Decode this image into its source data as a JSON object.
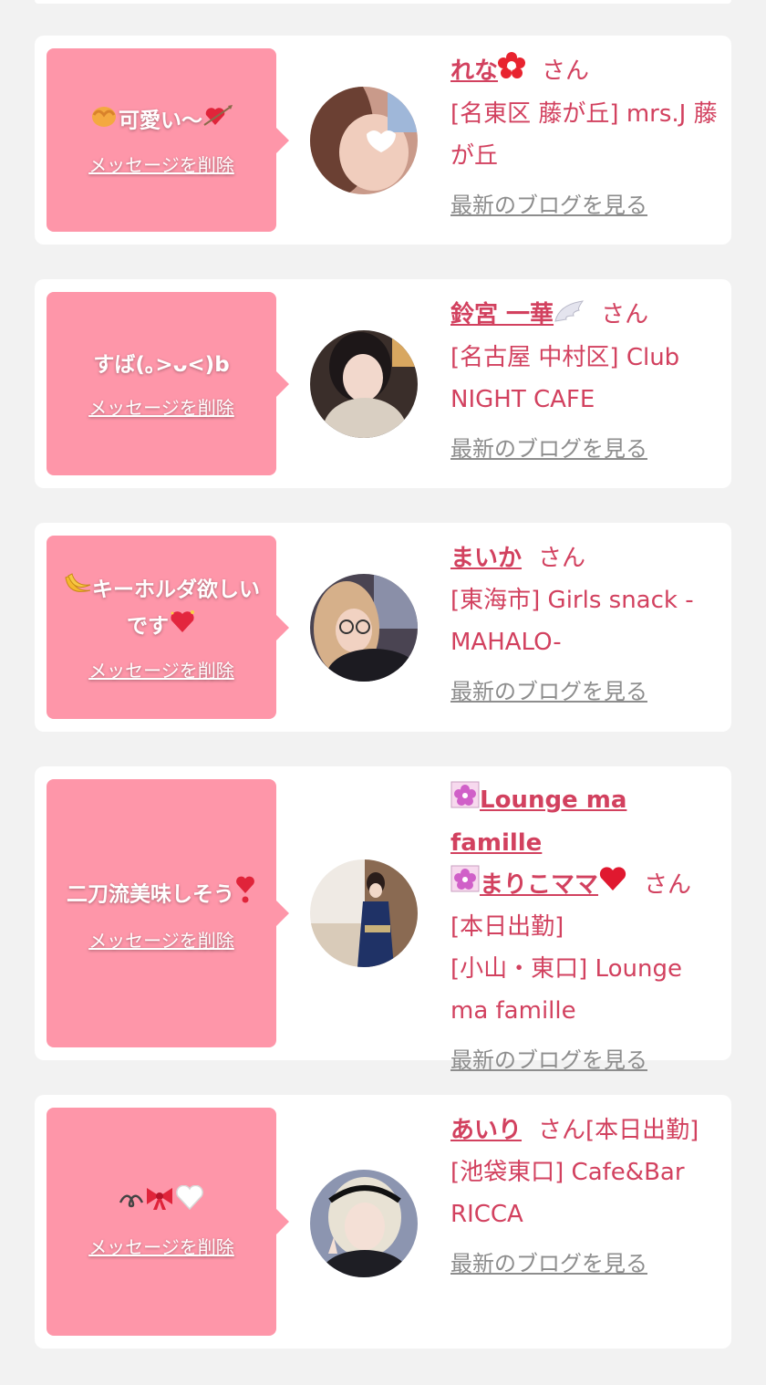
{
  "delete_label": "メッセージを削除",
  "blog_label": "最新のブログを見る",
  "san_label": "さん",
  "colors": {
    "background": "#f2f2f2",
    "bubble": "#fe96a9",
    "accent": "#d2415f",
    "link_gray": "#8d8d8d"
  },
  "entries": [
    {
      "message": "可愛い〜",
      "message_icons": [
        "covering-face-icon",
        "heart-arrow-icon"
      ],
      "name": "れな",
      "name_icon": "red-flower-icon",
      "shop": "[名東区 藤が丘] mrs.J 藤が丘"
    },
    {
      "message": "すば(｡>ᴗ<)b",
      "name": "鈴宮 一華",
      "name_icon": "wing-icon",
      "shop": "[名古屋 中村区] Club NIGHT CAFE"
    },
    {
      "message": "キーホルダ欲しいです",
      "message_icons": [
        "banana-icon",
        "sparkling-heart-icon"
      ],
      "name": "まいか",
      "shop": "[東海市] Girls snack -MAHALO-"
    },
    {
      "message": "二刀流美味しそう",
      "message_icons": [
        "exclamation-heart-icon"
      ],
      "name_line1": "Lounge ma famille",
      "name_line2": "まりこママ",
      "name_icons": [
        "cherry-blossom-icon",
        "cherry-blossom-icon",
        "red-heart-icon"
      ],
      "san_suffix": "[本日出勤]",
      "shop": "[小山・東口] Lounge ma famille"
    },
    {
      "message": "➰🎀🤍",
      "message_icons": [
        "curly-loop-icon",
        "ribbon-icon",
        "white-heart-icon"
      ],
      "name": "あいり",
      "san_suffix": "[本日出勤]",
      "shop": "[池袋東口] Cafe&Bar RICCA"
    }
  ]
}
